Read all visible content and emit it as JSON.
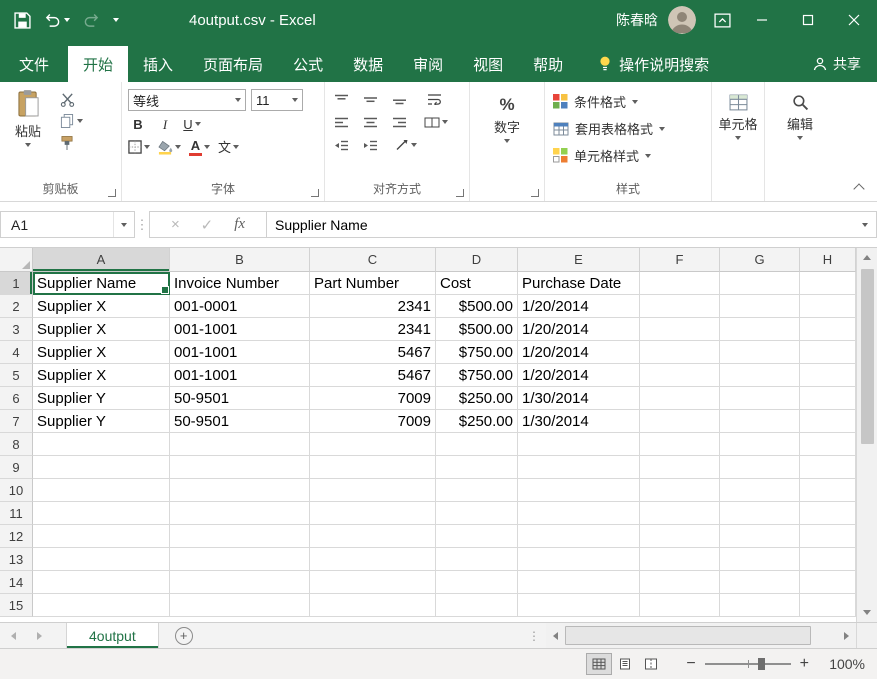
{
  "colors": {
    "accent": "#217346",
    "titlebar": "#217346",
    "fill_yellow": "#ffd34d",
    "font_red": "#e03c31"
  },
  "titlebar": {
    "title": "4output.csv - Excel",
    "user_name": "陈春晗"
  },
  "ribbon": {
    "tabs": [
      {
        "id": "file",
        "label": "文件",
        "active": false
      },
      {
        "id": "home",
        "label": "开始",
        "active": true
      },
      {
        "id": "insert",
        "label": "插入",
        "active": false
      },
      {
        "id": "page-layout",
        "label": "页面布局",
        "active": false
      },
      {
        "id": "formulas",
        "label": "公式",
        "active": false
      },
      {
        "id": "data",
        "label": "数据",
        "active": false
      },
      {
        "id": "review",
        "label": "审阅",
        "active": false
      },
      {
        "id": "view",
        "label": "视图",
        "active": false
      },
      {
        "id": "help",
        "label": "帮助",
        "active": false
      }
    ],
    "tell_me": "操作说明搜索",
    "share": "共享",
    "clipboard": {
      "label": "剪贴板",
      "paste": "粘贴"
    },
    "font": {
      "label": "字体",
      "font_name": "等线",
      "font_size": "11"
    },
    "alignment": {
      "label": "对齐方式"
    },
    "number": {
      "label": "数字"
    },
    "styles": {
      "label": "样式",
      "items": [
        "条件格式",
        "套用表格格式",
        "单元格样式"
      ]
    },
    "cells": {
      "label": "单元格"
    },
    "editing": {
      "label": "编辑"
    }
  },
  "glyphs": {
    "bold": "B",
    "italic": "I",
    "underline": "U",
    "font_color": "A",
    "phonetic": "文",
    "percent": "%",
    "fx": "fx",
    "cancel": "×",
    "enter": "✓",
    "dots_handle": "⋮",
    "plus": "+",
    "zoom_out": "−",
    "zoom_in": "+"
  },
  "formula_bar": {
    "name_box": "A1",
    "value": "Supplier Name"
  },
  "grid": {
    "selection": "A1",
    "column_headers": [
      "A",
      "B",
      "C",
      "D",
      "E",
      "F",
      "G",
      "H"
    ],
    "visible_rows": 15,
    "rows": [
      [
        "Supplier Name",
        "Invoice Number",
        "Part Number",
        "Cost",
        "Purchase Date",
        "",
        "",
        ""
      ],
      [
        "Supplier X",
        "001-0001",
        "2341",
        "$500.00",
        "1/20/2014",
        "",
        "",
        ""
      ],
      [
        "Supplier X",
        "001-1001",
        "2341",
        "$500.00",
        "1/20/2014",
        "",
        "",
        ""
      ],
      [
        "Supplier X",
        "001-1001",
        "5467",
        "$750.00",
        "1/20/2014",
        "",
        "",
        ""
      ],
      [
        "Supplier X",
        "001-1001",
        "5467",
        "$750.00",
        "1/20/2014",
        "",
        "",
        ""
      ],
      [
        "Supplier Y",
        "50-9501",
        "7009",
        "$250.00",
        "1/30/2014",
        "",
        "",
        ""
      ],
      [
        "Supplier Y",
        "50-9501",
        "7009",
        "$250.00",
        "1/30/2014",
        "",
        "",
        ""
      ]
    ]
  },
  "sheet_bar": {
    "tabs": [
      {
        "label": "4output",
        "active": true
      }
    ]
  },
  "status_bar": {
    "zoom": "100%"
  }
}
